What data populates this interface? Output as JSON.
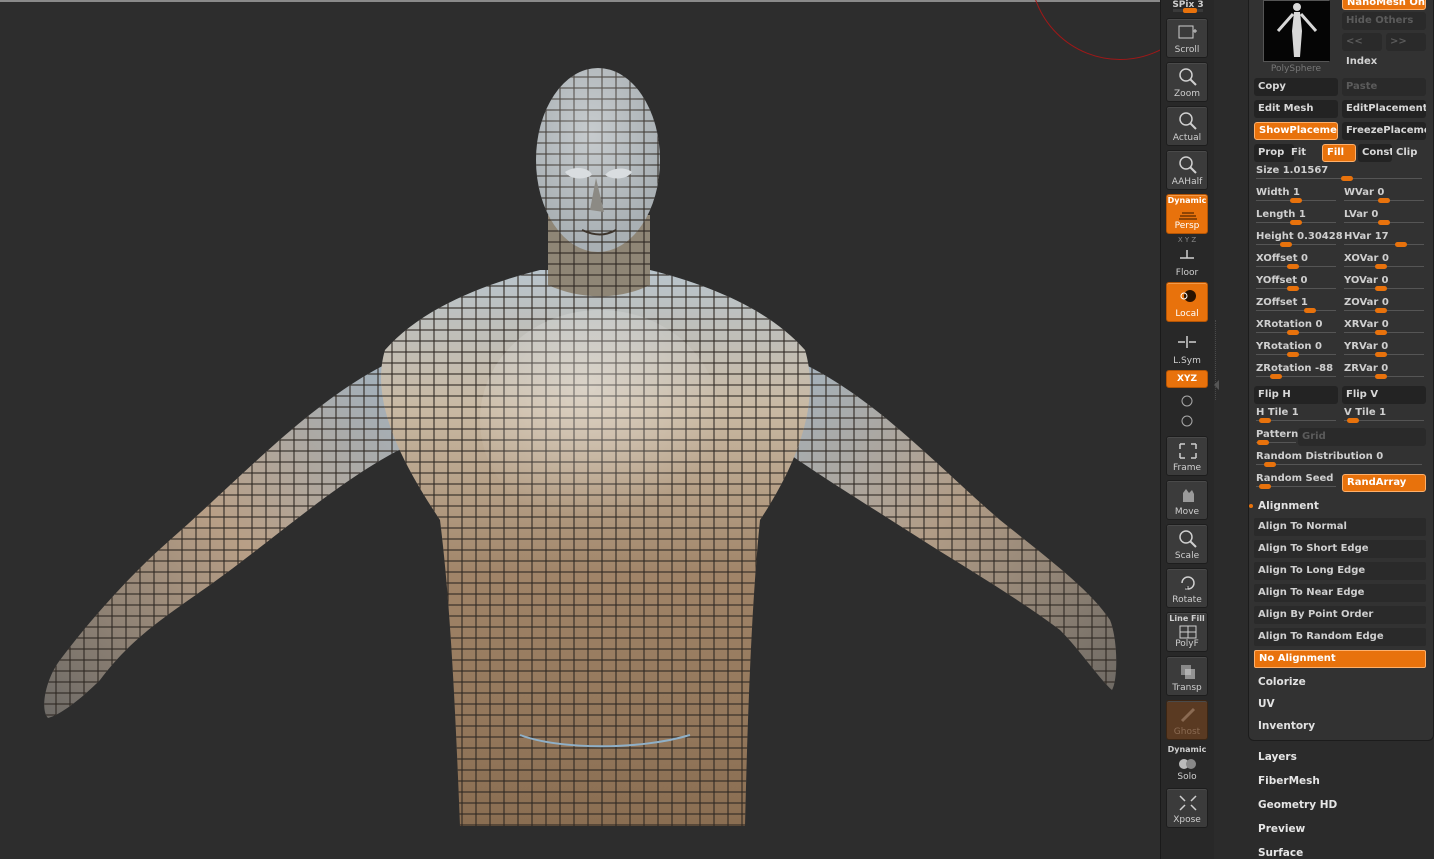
{
  "shelf": {
    "spix_label": "SPix 3",
    "buttons": {
      "scroll": "Scroll",
      "zoom": "Zoom",
      "actual": "Actual",
      "aahalf": "AAHalf",
      "persp_top": "Dynamic",
      "persp": "Persp",
      "floor": "Floor",
      "floor_axes": "X Y Z",
      "local": "Local",
      "lsym": "L.Sym",
      "xyz": "XYZ",
      "frame": "Frame",
      "move": "Move",
      "scale": "Scale",
      "rotate": "Rotate",
      "polyf_top": "Line Fill",
      "polyf": "PolyF",
      "transp": "Transp",
      "ghost": "Ghost",
      "solo_top": "Dynamic",
      "solo": "Solo",
      "xpose": "Xpose"
    }
  },
  "palette": {
    "top_button": "NanoMesh On",
    "thumb_label": "PolySphere",
    "hide_others": "Hide Others",
    "prev": "<<",
    "next": ">>",
    "index": "Index",
    "copy": "Copy",
    "paste": "Paste",
    "edit_mesh": "Edit Mesh",
    "edit_placement": "EditPlacement",
    "show_placement": "ShowPlacement",
    "freeze_placement": "FreezePlacement",
    "prop": "Prop",
    "fit": "Fit",
    "fill": "Fill",
    "const": "Const",
    "clip": "Clip",
    "size": "Size 1.01567",
    "width": "Width 1",
    "wvar": "WVar 0",
    "length": "Length 1",
    "lvar": "LVar 0",
    "height": "Height 0.30428",
    "hvar": "HVar 17",
    "xoffset": "XOffset 0",
    "xovar": "XOVar 0",
    "yoffset": "YOffset 0",
    "yovar": "YOVar 0",
    "zoffset": "ZOffset 1",
    "zovar": "ZOVar 0",
    "xrotation": "XRotation 0",
    "xrvar": "XRVar 0",
    "yrotation": "YRotation 0",
    "yrvar": "YRVar 0",
    "zrotation": "ZRotation -88",
    "zrvar": "ZRVar 0",
    "flip_h": "Flip H",
    "flip_v": "Flip V",
    "h_tile": "H Tile 1",
    "v_tile": "V Tile 1",
    "pattern": "Pattern",
    "pattern_value": "Grid",
    "random_distribution": "Random Distribution 0",
    "random_seed": "Random Seed",
    "randarray": "RandArray",
    "alignment": "Alignment",
    "align_items": [
      "Align To Normal",
      "Align To Short Edge",
      "Align To Long Edge",
      "Align To Near Edge",
      "Align By Point Order",
      "Align To Random Edge"
    ],
    "no_alignment": "No Alignment",
    "colorize": "Colorize",
    "uv": "UV",
    "inventory": "Inventory"
  },
  "subpalettes": [
    "Layers",
    "FiberMesh",
    "Geometry HD",
    "Preview",
    "Surface"
  ],
  "slider_values": {
    "size": 0.55,
    "width": 0.5,
    "wvar": 0.5,
    "length": 0.5,
    "lvar": 0.5,
    "height": 0.35,
    "hvar": 0.75,
    "xoffset": 0.45,
    "xovar": 0.45,
    "yoffset": 0.45,
    "yovar": 0.45,
    "zoffset": 0.7,
    "zovar": 0.45,
    "xrotation": 0.45,
    "xrvar": 0.45,
    "yrotation": 0.45,
    "yrvar": 0.45,
    "zrotation": 0.2,
    "zrvar": 0.45,
    "h_tile": 0.05,
    "v_tile": 0.05,
    "pattern": 0.05,
    "random_distribution": 0.05,
    "random_seed": 0.05
  },
  "colors": {
    "accent": "#e8720c",
    "background": "#2d2d2d",
    "panel": "#323232"
  }
}
